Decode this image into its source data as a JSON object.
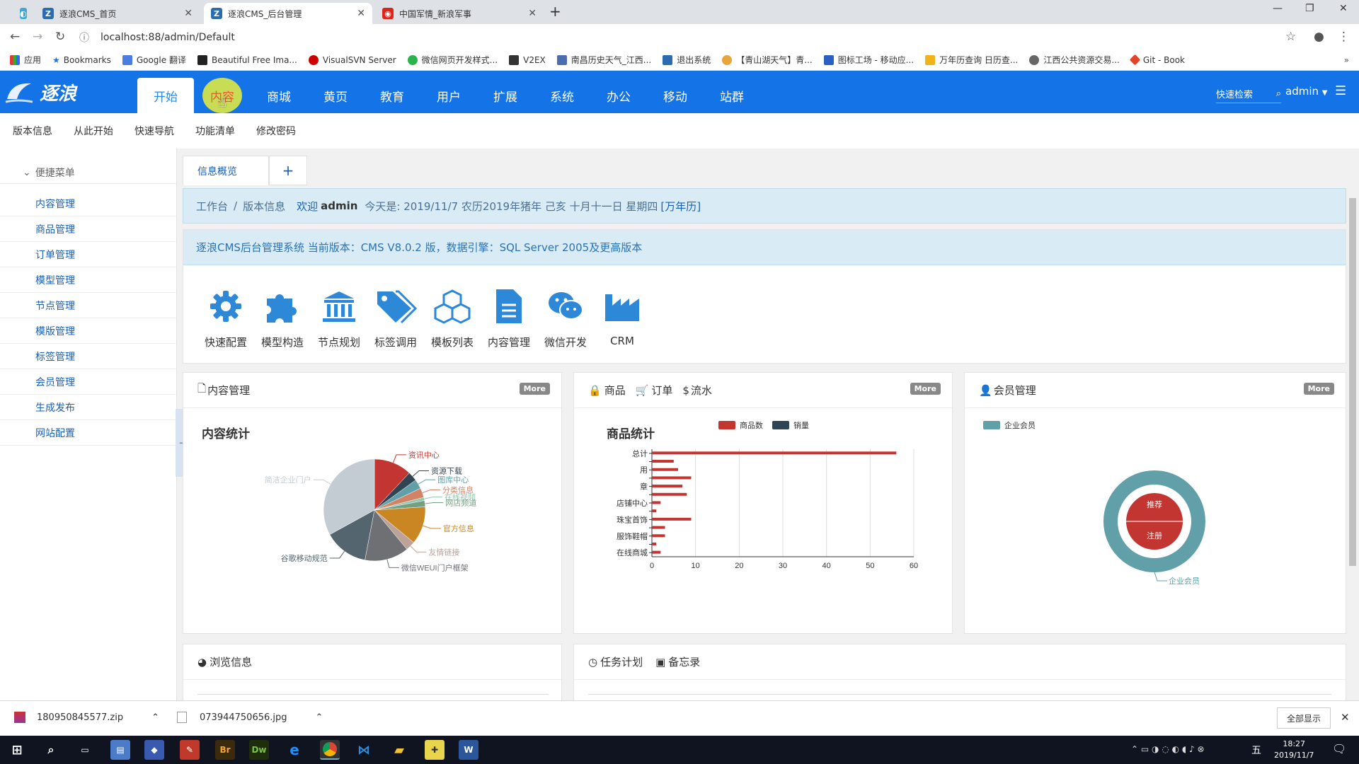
{
  "browser": {
    "tabs": [
      {
        "title": "逐浪CMS_首页"
      },
      {
        "title": "逐浪CMS_后台管理"
      },
      {
        "title": "中国军情_新浪军事"
      }
    ],
    "url": "localhost:88/admin/Default",
    "bookmarks": [
      "应用",
      "Bookmarks",
      "Google 翻译",
      "Beautiful Free Ima...",
      "VisualSVN Server",
      "微信网页开发样式...",
      "V2EX",
      "南昌历史天气_江西...",
      "退出系统",
      "【青山湖天气】青...",
      "图标工场 - 移动应...",
      "万年历查询 日历查...",
      "江西公共资源交易...",
      "Git - Book"
    ]
  },
  "app": {
    "logo": "逐浪",
    "nav": [
      "开始",
      "内容",
      "商城",
      "黄页",
      "教育",
      "用户",
      "扩展",
      "系统",
      "办公",
      "移动",
      "站群"
    ],
    "search_label": "快速检索",
    "user": "admin",
    "subnav": [
      "版本信息",
      "从此开始",
      "快速导航",
      "功能清单",
      "修改密码"
    ]
  },
  "sidebar": {
    "header": "便捷菜单",
    "items": [
      "内容管理",
      "商品管理",
      "订单管理",
      "模型管理",
      "节点管理",
      "模版管理",
      "标签管理",
      "会员管理",
      "生成发布",
      "网站配置"
    ]
  },
  "content": {
    "tab": "信息概览",
    "tab_add": "+",
    "crumb": {
      "home": "工作台",
      "sep": "/",
      "current": "版本信息",
      "welcome": "欢迎",
      "user": "admin",
      "date_text": "今天是: 2019/11/7 农历2019年猪年 己亥 十月十一日 星期四",
      "calendar_link": "[万年历]"
    },
    "version": "逐浪CMS后台管理系统 当前版本：CMS V8.0.2 版，数据引擎：SQL Server 2005及更高版本",
    "quick": [
      "快速配置",
      "模型构造",
      "节点规划",
      "标签调用",
      "模板列表",
      "内容管理",
      "微信开发",
      "CRM"
    ],
    "card_content": {
      "title": "内容管理",
      "more": "More",
      "chart_title": "内容统计"
    },
    "card_shop": {
      "tabs": [
        "商品",
        "订单",
        "流水"
      ],
      "more": "More",
      "chart_title": "商品统计"
    },
    "card_member": {
      "title": "会员管理",
      "more": "More"
    },
    "card_browse": {
      "title": "浏览信息"
    },
    "card_tasks": {
      "tabs": [
        "任务计划",
        "备忘录"
      ]
    }
  },
  "chart_data": [
    {
      "type": "pie",
      "title": "内容统计",
      "labels": [
        "资讯中心",
        "资源下载",
        "图库中心",
        "分类信息",
        "在线视频",
        "网店频道",
        "官方信息",
        "友情链接",
        "微信WEUI门户框架",
        "谷歌移动规范",
        "简洁企业门户"
      ],
      "values": [
        12,
        3,
        3,
        3,
        1,
        2,
        12,
        3,
        14,
        14,
        33
      ],
      "colors": [
        "#c23531",
        "#2f4554",
        "#61a0a8",
        "#d48265",
        "#91c7ae",
        "#749f83",
        "#ca8622",
        "#bda29a",
        "#6e7074",
        "#546570",
        "#c4ccd3"
      ]
    },
    {
      "type": "bar",
      "title": "商品统计",
      "orientation": "horizontal",
      "legend": [
        "商品数",
        "销量"
      ],
      "colors": [
        "#c23531",
        "#2f4554"
      ],
      "categories": [
        "在线商城",
        "",
        "服饰鞋帽",
        "",
        "珠宝首饰",
        "",
        "店铺中心",
        "",
        "章",
        "",
        "用",
        "",
        "总计"
      ],
      "series": [
        {
          "name": "商品数",
          "values": [
            2,
            1,
            3,
            3,
            9,
            1,
            2,
            8,
            7,
            9,
            6,
            5,
            56
          ]
        },
        {
          "name": "销量",
          "values": [
            0,
            0,
            0,
            0,
            0,
            0,
            0,
            0,
            0,
            0,
            0,
            0,
            0
          ]
        }
      ],
      "xlim": [
        0,
        60
      ],
      "xticks": [
        0,
        10,
        20,
        30,
        40,
        50,
        60
      ],
      "grid": true
    },
    {
      "type": "pie",
      "title": "",
      "legend": [
        "企业会员"
      ],
      "rings": [
        {
          "name": "企业会员",
          "value": 1,
          "color": "#61a0a8"
        },
        {
          "name": "推荐",
          "value": 1,
          "color": "#c23531"
        },
        {
          "name": "注册",
          "value": 1,
          "color": "#c23531"
        }
      ]
    }
  ],
  "downloads": {
    "items": [
      "180950845577.zip",
      "073944750656.jpg"
    ],
    "show_all": "全部显示"
  },
  "taskbar": {
    "time": "18:27",
    "date": "2019/11/7"
  }
}
